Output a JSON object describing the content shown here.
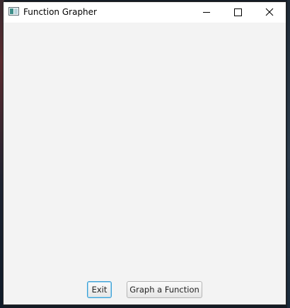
{
  "window": {
    "title": "Function Grapher",
    "icon": "app-window-icon"
  },
  "titlebar_controls": {
    "minimize_icon": "minimize-icon",
    "maximize_icon": "maximize-icon",
    "close_icon": "close-icon"
  },
  "buttons": {
    "exit_label": "Exit",
    "graph_label": "Graph a Function"
  },
  "colors": {
    "content_bg": "#f3f3f3",
    "titlebar_bg": "#ffffff",
    "focus_border": "#3aa0d6"
  }
}
